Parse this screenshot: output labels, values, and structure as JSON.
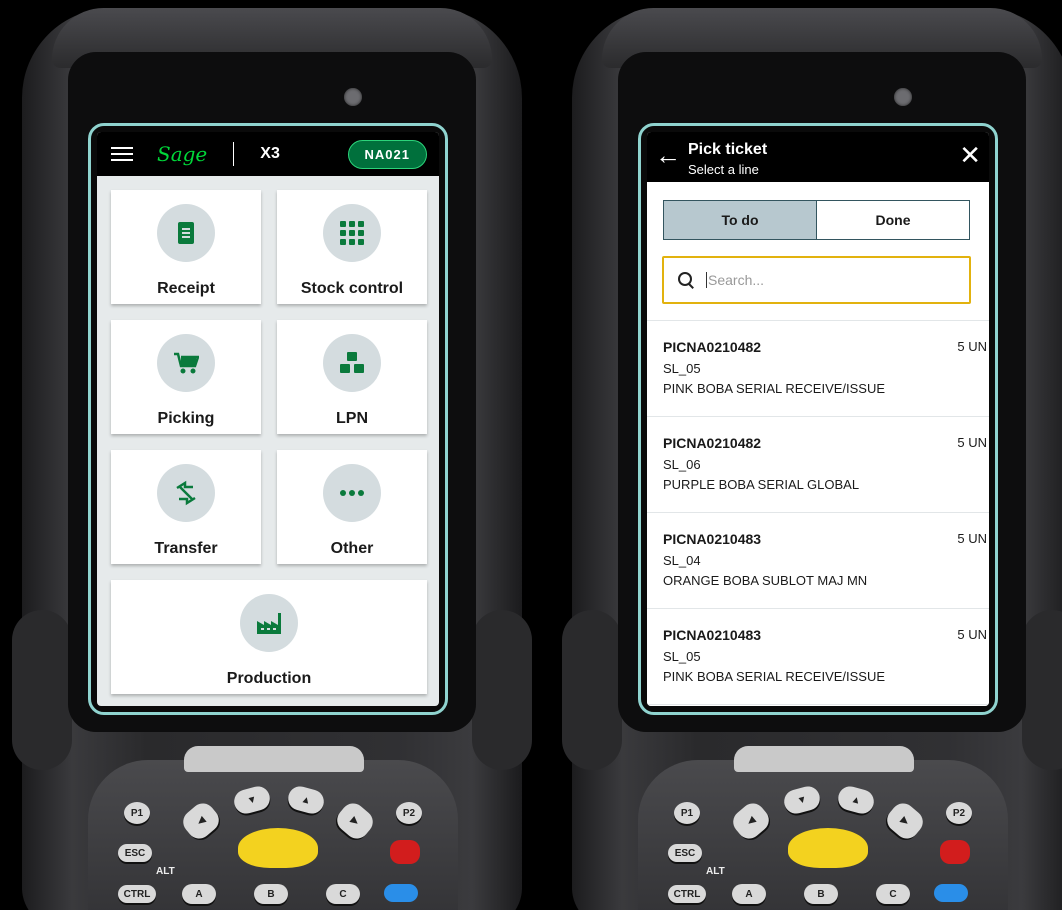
{
  "left_screen": {
    "app_bar": {
      "brand": "Sage",
      "product": "X3",
      "site": "NA021"
    },
    "tiles": [
      {
        "label": "Receipt",
        "icon": "receipt-icon"
      },
      {
        "label": "Stock control",
        "icon": "grid-icon"
      },
      {
        "label": "Picking",
        "icon": "cart-icon"
      },
      {
        "label": "LPN",
        "icon": "boxes-icon"
      },
      {
        "label": "Transfer",
        "icon": "transfer-icon"
      },
      {
        "label": "Other",
        "icon": "more-icon"
      },
      {
        "label": "Production",
        "icon": "factory-icon"
      }
    ]
  },
  "right_screen": {
    "header": {
      "title": "Pick ticket",
      "subtitle": "Select a line"
    },
    "tabs": [
      "To do",
      "Done"
    ],
    "active_tab": "To do",
    "search": {
      "placeholder": "Search..."
    },
    "lines": [
      {
        "ref": "PICNA0210482",
        "lot": "SL_05",
        "desc": "PINK BOBA SERIAL RECEIVE/ISSUE",
        "qty": "5 UN"
      },
      {
        "ref": "PICNA0210482",
        "lot": "SL_06",
        "desc": "PURPLE BOBA SERIAL GLOBAL",
        "qty": "5 UN"
      },
      {
        "ref": "PICNA0210483",
        "lot": "SL_04",
        "desc": "ORANGE BOBA SUBLOT MAJ MN",
        "qty": "5 UN"
      },
      {
        "ref": "PICNA0210483",
        "lot": "SL_05",
        "desc": "PINK BOBA SERIAL RECEIVE/ISSUE",
        "qty": "5 UN"
      }
    ]
  },
  "keypad": {
    "keys": [
      "P1",
      "P2",
      "ESC",
      "ALT",
      "CTRL",
      "A",
      "B",
      "C"
    ]
  },
  "colors": {
    "brand_green": "#00d639",
    "badge_green": "#00703c",
    "icon_green": "#0a7a3c",
    "tile_icon_bg": "#d4dcdf",
    "search_focus": "#e2b20e",
    "active_tab_bg": "#b7c8cf",
    "screen_border": "#8fd3cf"
  }
}
